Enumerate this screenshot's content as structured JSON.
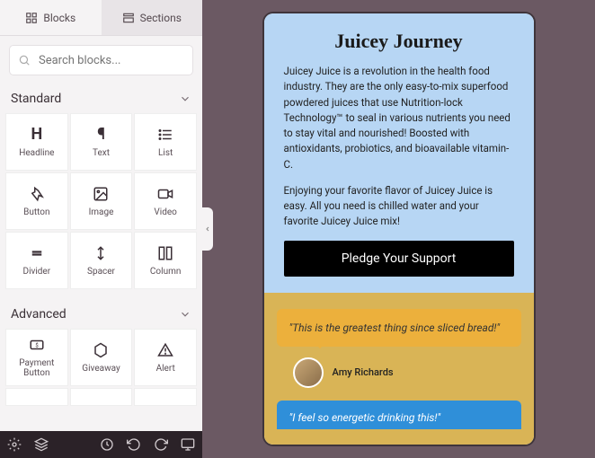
{
  "tabs": {
    "blocks": "Blocks",
    "sections": "Sections"
  },
  "search": {
    "placeholder": "Search blocks..."
  },
  "sections": {
    "standard": {
      "title": "Standard",
      "items": [
        "Headline",
        "Text",
        "List",
        "Button",
        "Image",
        "Video",
        "Divider",
        "Spacer",
        "Column"
      ]
    },
    "advanced": {
      "title": "Advanced",
      "items": [
        "Payment Button",
        "Giveaway",
        "Alert"
      ]
    }
  },
  "preview": {
    "title": "Juicey Journey",
    "p1": "Juicey Juice is a revolution in the health food industry. They are the only easy-to-mix superfood powdered juices that use Nutrition-lock Technology™ to seal in various nutrients you need to stay vital and nourished! Boosted with antioxidants, probiotics, and bioavailable vitamin-C.",
    "p2": "Enjoying your favorite flavor of Juicey Juice is easy. All you need is chilled water and your favorite Juicey Juice mix!",
    "cta": "Pledge Your Support",
    "quote1": "\"This is the greatest thing since sliced bread!\"",
    "author1": "Amy Richards",
    "quote2": "\"I feel so energetic drinking this!\""
  }
}
